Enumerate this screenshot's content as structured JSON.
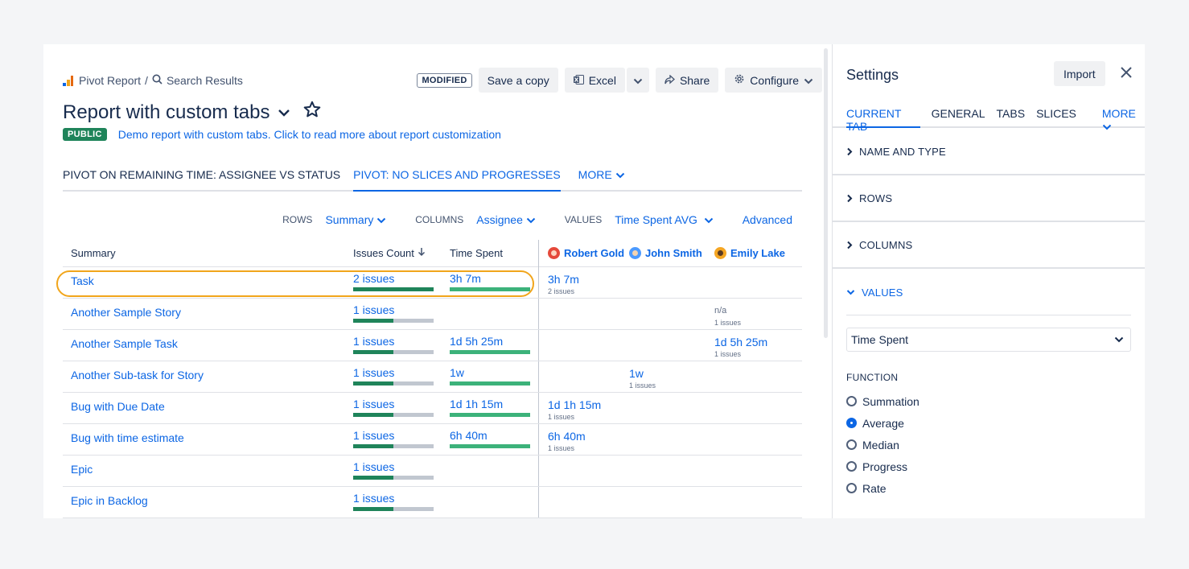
{
  "breadcrumbs": {
    "root": "Pivot Report",
    "separator": "/",
    "current": "Search Results"
  },
  "toolbar": {
    "modified_badge": "MODIFIED",
    "save_copy": "Save a copy",
    "excel": "Excel",
    "share": "Share",
    "configure": "Configure"
  },
  "report": {
    "title": "Report with custom tabs",
    "visibility": "PUBLIC",
    "description": "Demo report with custom tabs. Click to read more about report customization"
  },
  "tabs": [
    {
      "label": "PIVOT ON REMAINING TIME: ASSIGNEE VS STATUS",
      "active": false
    },
    {
      "label": "PIVOT: NO SLICES AND PROGRESSES",
      "active": true
    },
    {
      "label": "MORE",
      "active": false
    }
  ],
  "filters": {
    "rows_label": "ROWS",
    "rows_value": "Summary",
    "columns_label": "COLUMNS",
    "columns_value": "Assignee",
    "values_label": "VALUES",
    "values_value": "Time Spent AVG",
    "advanced": "Advanced"
  },
  "table": {
    "headers": {
      "summary": "Summary",
      "issues_count": "Issues Count",
      "time_spent": "Time Spent",
      "robert": "Robert Gold",
      "john": "John Smith",
      "emily": "Emily Lake"
    },
    "rows": [
      {
        "summary": "Task",
        "count": "2 issues",
        "count_fill": 1.0,
        "time": "3h 7m",
        "time_fill": 1.0,
        "robert": "3h 7m",
        "robert_sub": "2 issues",
        "john": "",
        "john_sub": "",
        "emily": "",
        "emily_sub": ""
      },
      {
        "summary": "Another Sample Story",
        "count": "1 issues",
        "count_fill": 0.5,
        "time": "",
        "time_fill": 0,
        "robert": "",
        "robert_sub": "",
        "john": "",
        "john_sub": "",
        "emily": "n/a",
        "emily_sub": "1 issues"
      },
      {
        "summary": "Another Sample Task",
        "count": "1 issues",
        "count_fill": 0.5,
        "time": "1d 5h 25m",
        "time_fill": 1.0,
        "robert": "",
        "robert_sub": "",
        "john": "",
        "john_sub": "",
        "emily": "1d 5h 25m",
        "emily_sub": "1 issues"
      },
      {
        "summary": "Another Sub-task for Story",
        "count": "1 issues",
        "count_fill": 0.5,
        "time": "1w",
        "time_fill": 1.0,
        "robert": "",
        "robert_sub": "",
        "john": "1w",
        "john_sub": "1 issues",
        "emily": "",
        "emily_sub": ""
      },
      {
        "summary": "Bug with Due Date",
        "count": "1 issues",
        "count_fill": 0.5,
        "time": "1d 1h 15m",
        "time_fill": 1.0,
        "robert": "1d 1h 15m",
        "robert_sub": "1 issues",
        "john": "",
        "john_sub": "",
        "emily": "",
        "emily_sub": ""
      },
      {
        "summary": "Bug with time estimate",
        "count": "1 issues",
        "count_fill": 0.5,
        "time": "6h 40m",
        "time_fill": 1.0,
        "robert": "6h 40m",
        "robert_sub": "1 issues",
        "john": "",
        "john_sub": "",
        "emily": "",
        "emily_sub": ""
      },
      {
        "summary": "Epic",
        "count": "1 issues",
        "count_fill": 0.5,
        "time": "",
        "time_fill": 0,
        "robert": "",
        "robert_sub": "",
        "john": "",
        "john_sub": "",
        "emily": "",
        "emily_sub": ""
      },
      {
        "summary": "Epic in Backlog",
        "count": "1 issues",
        "count_fill": 0.5,
        "time": "",
        "time_fill": 0,
        "robert": "",
        "robert_sub": "",
        "john": "",
        "john_sub": "",
        "emily": "",
        "emily_sub": ""
      }
    ]
  },
  "settings": {
    "title": "Settings",
    "import": "Import",
    "tabs": [
      "CURRENT TAB",
      "GENERAL",
      "TABS",
      "SLICES",
      "MORE"
    ],
    "sections": [
      "NAME AND TYPE",
      "ROWS",
      "COLUMNS",
      "VALUES"
    ],
    "value_select": "Time Spent",
    "function_label": "FUNCTION",
    "functions": [
      {
        "label": "Summation",
        "selected": false
      },
      {
        "label": "Average",
        "selected": true
      },
      {
        "label": "Median",
        "selected": false
      },
      {
        "label": "Progress",
        "selected": false
      },
      {
        "label": "Rate",
        "selected": false
      }
    ]
  },
  "colors": {
    "accent": "#0c66e4",
    "bar_green": "#1f845a",
    "bar_time": "#3cb27a",
    "highlight": "#f1a51b",
    "public_badge": "#1f845a"
  }
}
